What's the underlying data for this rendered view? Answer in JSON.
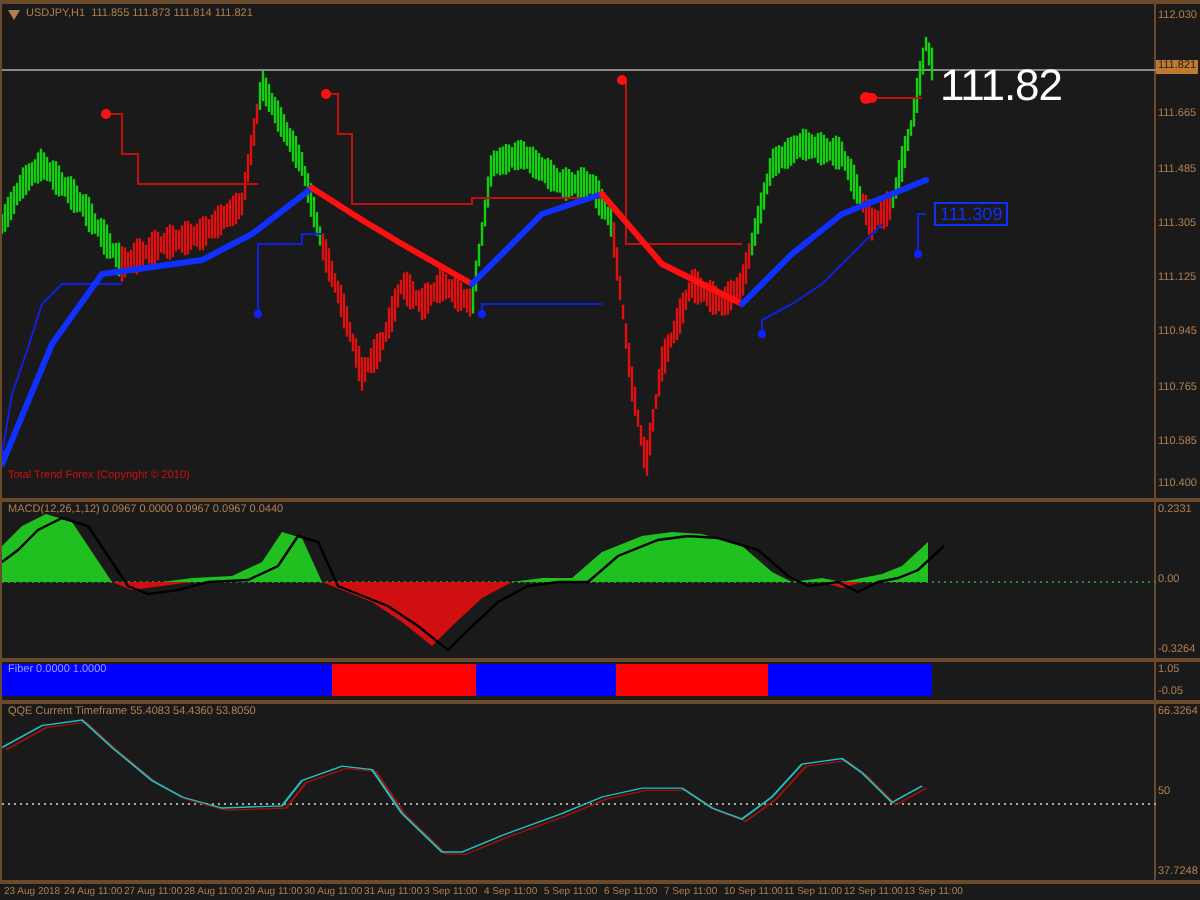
{
  "main_panel": {
    "symbol": "USDJPY,H1",
    "ohlc": "111.855 111.873 111.814 111.821",
    "current_price": "111.821",
    "big_price_label": "111.82",
    "level_label": "111.309",
    "indicator_caption": "Total Trend Forex (Copyright © 2010)",
    "price_ticks": [
      "112.030",
      "111.665",
      "111.485",
      "111.305",
      "111.125",
      "110.945",
      "110.765",
      "110.585",
      "110.400"
    ]
  },
  "macd_panel": {
    "caption": "MACD(12,26,1,12) 0.0967 0.0000 0.0967 0.0967 0.0440",
    "ticks": [
      "0.2331",
      "0.00",
      "-0.3264"
    ]
  },
  "fiber_panel": {
    "caption": "Fiber 0.0000 1.0000",
    "ticks": [
      "1.05",
      "-0.05"
    ]
  },
  "qqe_panel": {
    "caption": "QQE Current Timeframe 55.4083 54.4360 53.8050",
    "ticks": [
      "66.3264",
      "50",
      "37.7248"
    ]
  },
  "time_axis": [
    "23 Aug 2018",
    "24 Aug 11:00",
    "27 Aug 11:00",
    "28 Aug 11:00",
    "29 Aug 11:00",
    "30 Aug 11:00",
    "31 Aug 11:00",
    "3 Sep 11:00",
    "4 Sep 11:00",
    "5 Sep 11:00",
    "6 Sep 11:00",
    "7 Sep 11:00",
    "10 Sep 11:00",
    "11 Sep 11:00",
    "12 Sep 11:00",
    "13 Sep 11:00"
  ]
}
